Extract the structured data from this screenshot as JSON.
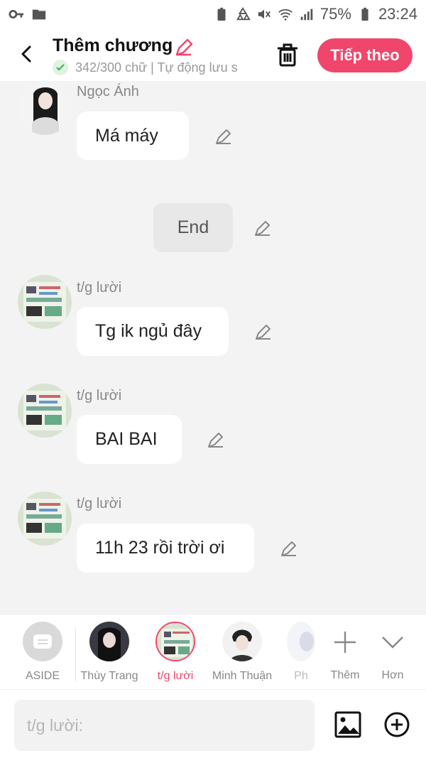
{
  "status_bar": {
    "battery_percent": "75%",
    "time": "23:24"
  },
  "header": {
    "title": "Thêm chương",
    "word_count": "342/300 chữ | Tự động lưu s",
    "next_label": "Tiếp theo"
  },
  "messages": [
    {
      "name": "Ngọc Ánh",
      "text": "Má máy"
    },
    {
      "text": "End"
    },
    {
      "name": "t/g lười",
      "text": "Tg ik ngủ đây"
    },
    {
      "name": "t/g lười",
      "text": "BAI BAI"
    },
    {
      "name": "t/g lười",
      "text": "11h 23 rồi trời ơi"
    }
  ],
  "characters": [
    {
      "label": "ASIDE"
    },
    {
      "label": "Thùy Trang"
    },
    {
      "label": "t/g lười"
    },
    {
      "label": "Minh Thuận"
    },
    {
      "label": "Ph"
    }
  ],
  "actions": {
    "add_label": "Thêm",
    "more_label": "Hơn"
  },
  "composer": {
    "placeholder": "t/g lười:"
  },
  "colors": {
    "accent": "#f0466b",
    "background": "#f3f3f3"
  }
}
